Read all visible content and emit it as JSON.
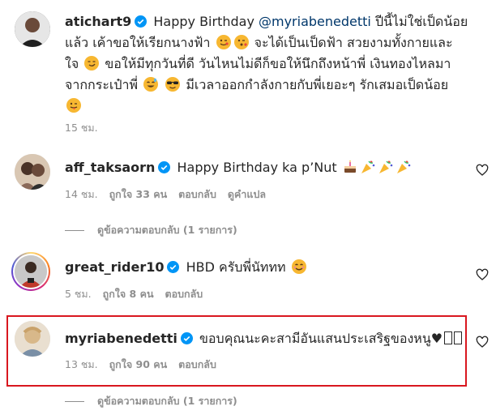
{
  "comments": [
    {
      "username": "atichart9",
      "text_before_mention": " Happy Birthday ",
      "mention": "@myriabenedetti",
      "text_after": " ปีนี้ไม่ใช่เป็ดน้อย แล้ว เค้าขอให้เรียกนางฟ้า",
      "text_2": " จะได้เป็นเป็ดฟ้า สวยงามทั้งกายและ ใจ",
      "text_3": " ขอให้มีทุกวันที่ดี วันไหนไม่ดีก็ขอให้นึกถึงหน้าพี่ เงินทองไหลมา จากกระเป๋าพี่",
      "text_4": " มีเวลาออกกำลังกายกับพี่เยอะๆ รักเสมอเป็ดน้อย",
      "time": "15 ชม."
    },
    {
      "username": "aff_taksaorn",
      "text": " Happy Birthday ka p’Nut",
      "time": "14 ชม.",
      "likes": "ถูกใจ 33 คน",
      "reply": "ตอบกลับ",
      "translate": "ดูคำแปล"
    },
    {
      "username": "great_rider10",
      "text": " HBD ครับพี่นัททท",
      "time": "5 ชม.",
      "likes": "ถูกใจ 8 คน",
      "reply": "ตอบกลับ"
    },
    {
      "username": "myriabenedetti",
      "text": " ขอบคุณนะคะสามีอันแสนประเสริฐของหนู♥",
      "time": "13 ชม.",
      "likes": "ถูกใจ 90 คน",
      "reply": "ตอบกลับ"
    }
  ],
  "view_replies": [
    "ดูข้อความตอบกลับ (1 รายการ)",
    "ดูข้อความตอบกลับ (1 รายการ)"
  ],
  "colors": {
    "verified": "#0095f6",
    "mention": "#00376b",
    "meta": "#8e8e8e",
    "highlight_border": "#d9171f"
  },
  "icons": [
    "verified-badge-icon",
    "heart-icon",
    "emoji-icon"
  ]
}
